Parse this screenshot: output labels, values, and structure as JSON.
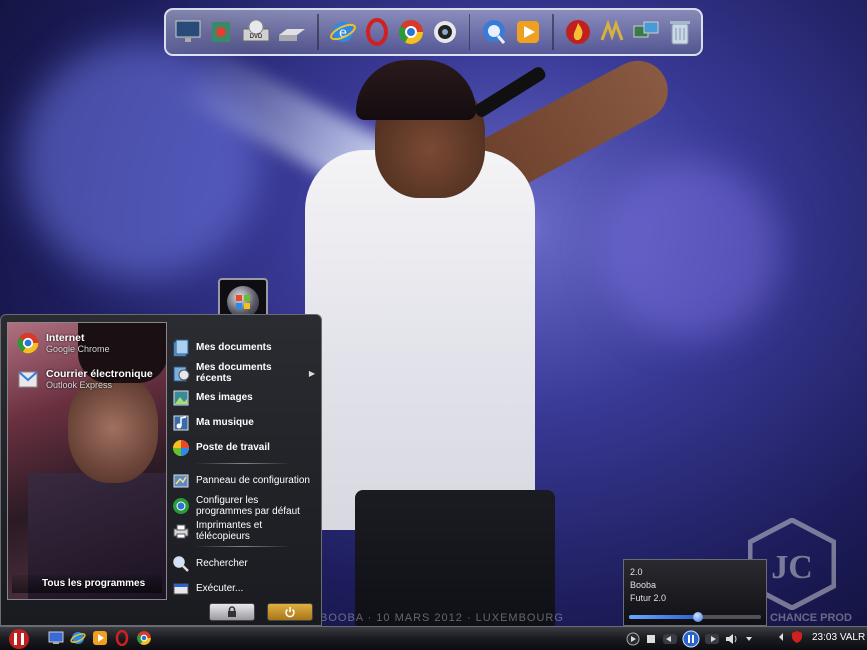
{
  "wallpaper": {
    "watermark_text": "BOOBA · 10 MARS 2012 · LUXEMBOURG",
    "logo_text": "CHANCE PROD"
  },
  "dock": {
    "icons": [
      "monitor-icon",
      "notebook-icon",
      "dvd-drive-icon",
      "hard-drive-icon",
      "ie-icon",
      "opera-icon",
      "chrome-icon",
      "media-icon",
      "quicktime-icon",
      "media-player-icon",
      "fire-icon",
      "winamp-icon",
      "network-icon",
      "recycle-bin-icon"
    ]
  },
  "start_menu": {
    "pinned": [
      {
        "title": "Internet",
        "subtitle": "Google Chrome",
        "icon": "chrome-icon"
      },
      {
        "title": "Courrier électronique",
        "subtitle": "Outlook Express",
        "icon": "mail-icon"
      }
    ],
    "all_programs": "Tous les programmes",
    "right_items": [
      {
        "label": "Mes documents",
        "bold": true,
        "icon": "folder-icon"
      },
      {
        "label": "Mes documents récents",
        "bold": true,
        "icon": "folder-recent-icon",
        "submenu": true
      },
      {
        "label": "Mes images",
        "bold": true,
        "icon": "pictures-icon"
      },
      {
        "label": "Ma musique",
        "bold": true,
        "icon": "music-icon"
      },
      {
        "label": "Poste de travail",
        "bold": true,
        "icon": "computer-icon"
      }
    ],
    "system_items": [
      {
        "label": "Panneau de configuration",
        "icon": "control-panel-icon"
      },
      {
        "label": "Configurer les programmes par défaut",
        "icon": "default-programs-icon"
      },
      {
        "label": "Imprimantes et télécopieurs",
        "icon": "printer-icon"
      }
    ],
    "misc_items": [
      {
        "label": "Rechercher",
        "icon": "search-icon"
      },
      {
        "label": "Exécuter...",
        "icon": "run-icon"
      }
    ]
  },
  "media_popup": {
    "version": "2.0",
    "artist": "Booba",
    "track": "Futur 2.0",
    "progress": 0.52
  },
  "taskbar": {
    "quick_launch": [
      "desktop-icon",
      "ie-icon",
      "media-player-icon",
      "opera-icon",
      "chrome-icon"
    ],
    "clock": "23:03",
    "clock_suffix": "VALR"
  },
  "colors": {
    "accent_blue": "#2a62d0",
    "power_orange": "#c88a20",
    "menu_bg": "#1a1b20"
  }
}
